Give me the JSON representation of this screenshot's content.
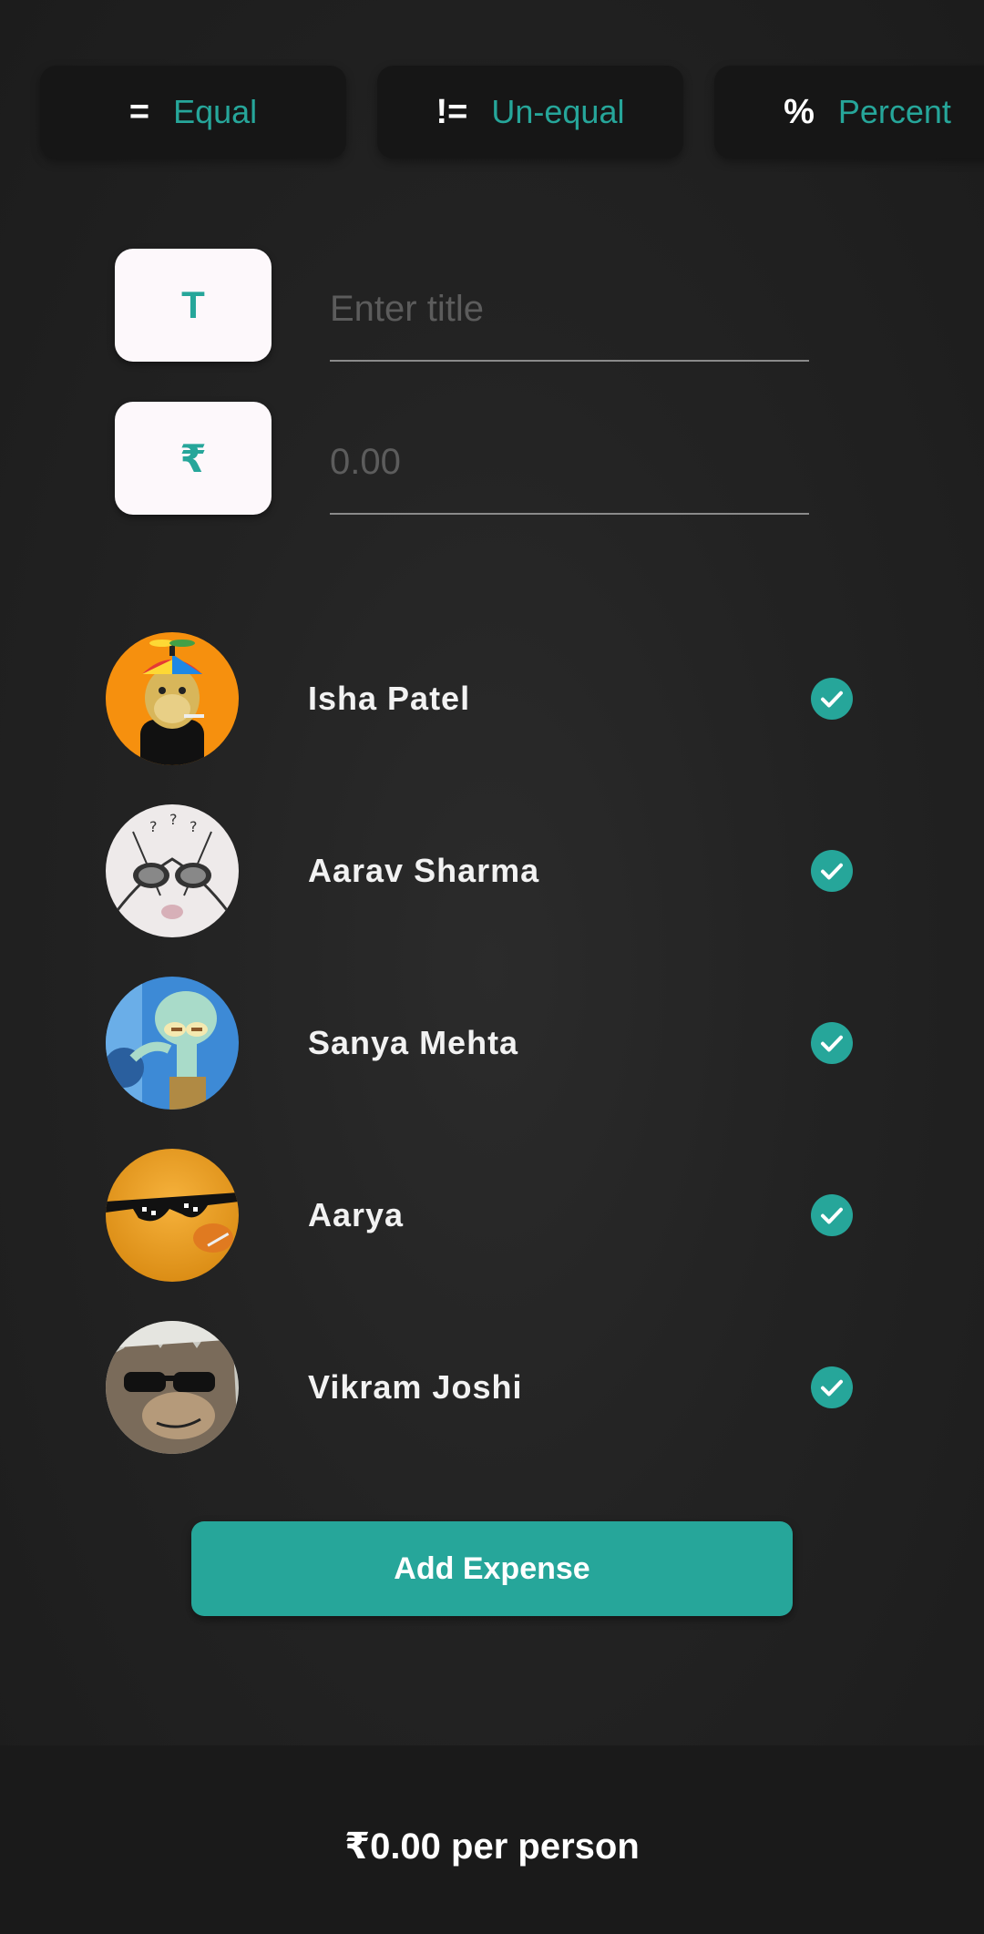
{
  "split_tabs": [
    {
      "symbol": "=",
      "label": "Equal"
    },
    {
      "symbol": "!=",
      "label": "Un-equal"
    },
    {
      "symbol": "%",
      "label": "Percent"
    }
  ],
  "title_field": {
    "icon": "T",
    "placeholder": "Enter title",
    "value": ""
  },
  "amount_field": {
    "icon": "₹",
    "placeholder": "0.00",
    "value": ""
  },
  "members": [
    {
      "name": "Isha Patel",
      "selected": true
    },
    {
      "name": "Aarav Sharma",
      "selected": true
    },
    {
      "name": "Sanya Mehta",
      "selected": true
    },
    {
      "name": "Aarya",
      "selected": true
    },
    {
      "name": "Vikram Joshi",
      "selected": true
    }
  ],
  "add_button": {
    "label": "Add Expense"
  },
  "footer": {
    "per_person": "₹0.00 per person"
  },
  "colors": {
    "accent": "#26a69a",
    "background": "#232323",
    "field_bg": "#fdf8fb"
  }
}
